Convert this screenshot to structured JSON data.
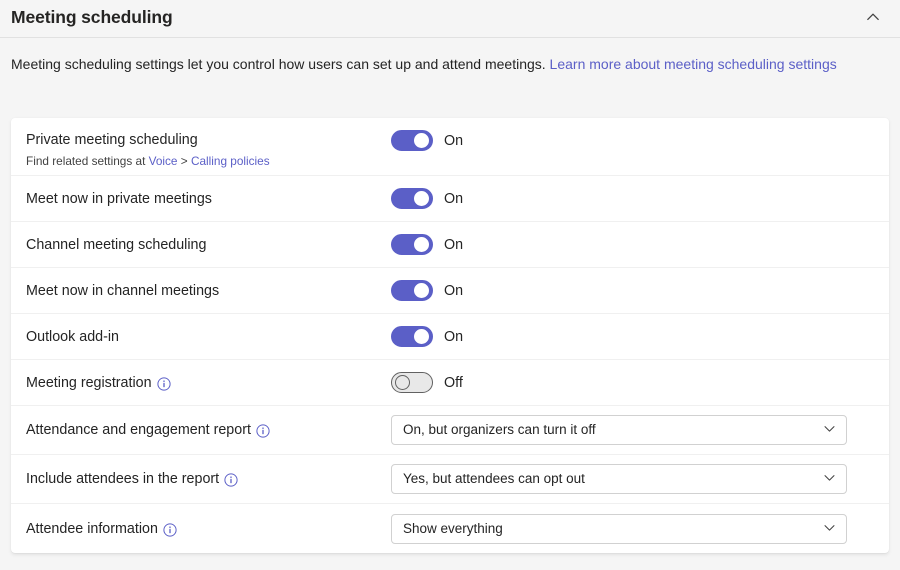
{
  "header": {
    "title": "Meeting scheduling",
    "collapse_icon": "chevron-up-icon"
  },
  "description": {
    "text": "Meeting scheduling settings let you control how users can set up and attend meetings. ",
    "link_text": "Learn more about meeting scheduling settings"
  },
  "colors": {
    "accent": "#5b5fc7",
    "link": "#5b5fc7",
    "page_bg": "#f5f5f5",
    "card_bg": "#ffffff",
    "toggle_on": "#5b5fc7",
    "toggle_off": "#e8e8e8",
    "divider": "#f0f0f0"
  },
  "settings": [
    {
      "id": "private-meeting-scheduling",
      "label": "Private meeting scheduling",
      "sub_prefix": "Find related settings at ",
      "sub_link1": "Voice",
      "sub_sep": " > ",
      "sub_link2": "Calling policies",
      "control": "toggle",
      "state": "On"
    },
    {
      "id": "meet-now-in-private-meetings",
      "label": "Meet now in private meetings",
      "control": "toggle",
      "state": "On"
    },
    {
      "id": "channel-meeting-scheduling",
      "label": "Channel meeting scheduling",
      "control": "toggle",
      "state": "On"
    },
    {
      "id": "meet-now-in-channel-meetings",
      "label": "Meet now in channel meetings",
      "control": "toggle",
      "state": "On"
    },
    {
      "id": "outlook-add-in",
      "label": "Outlook add-in",
      "control": "toggle",
      "state": "On"
    },
    {
      "id": "meeting-registration",
      "label": "Meeting registration",
      "info": "info-icon",
      "control": "toggle",
      "state": "Off"
    },
    {
      "id": "attendance-and-engagement-report",
      "label": "Attendance and engagement report",
      "info": "info-icon",
      "control": "dropdown",
      "value": "On, but organizers can turn it off"
    },
    {
      "id": "include-attendees-in-the-report",
      "label": "Include attendees in the report",
      "info": "info-icon",
      "control": "dropdown",
      "value": "Yes, but attendees can opt out"
    },
    {
      "id": "attendee-information",
      "label": "Attendee information",
      "info": "info-icon",
      "control": "dropdown",
      "value": "Show everything"
    }
  ]
}
